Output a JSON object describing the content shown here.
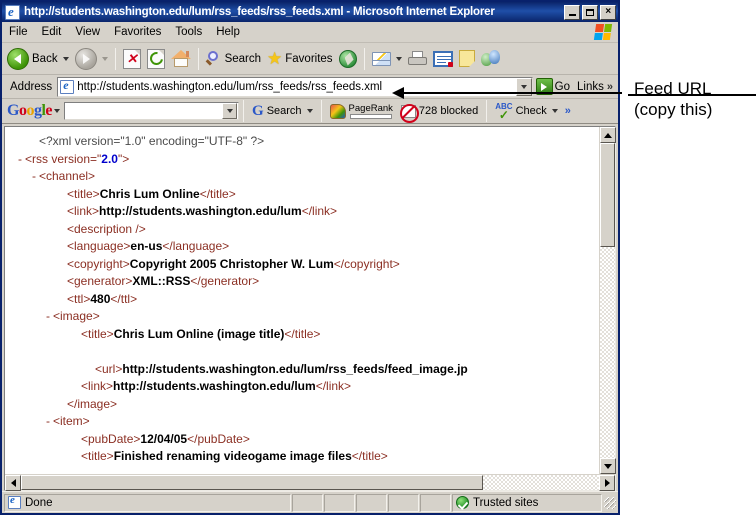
{
  "window": {
    "title": "http://students.washington.edu/lum/rss_feeds/rss_feeds.xml - Microsoft Internet Explorer",
    "icon": "ie-page-icon",
    "minimize_label": "_",
    "maximize_label": "",
    "close_label": "×"
  },
  "menubar": {
    "items": [
      {
        "label": "File"
      },
      {
        "label": "Edit"
      },
      {
        "label": "View"
      },
      {
        "label": "Favorites"
      },
      {
        "label": "Tools"
      },
      {
        "label": "Help"
      }
    ],
    "brand_icon": "windows-flag-icon"
  },
  "toolbar": {
    "back_label": "Back",
    "forward_label": "",
    "search_label": "Search",
    "favorites_label": "Favorites",
    "icons": [
      "back-icon",
      "forward-icon",
      "stop-icon",
      "refresh-icon",
      "home-icon",
      "search-icon",
      "favorites-star-icon",
      "media-icon",
      "mail-icon",
      "print-icon",
      "edit-icon",
      "notes-icon",
      "messenger-icon"
    ]
  },
  "addressbar": {
    "label": "Address",
    "url": "http://students.washington.edu/lum/rss_feeds/rss_feeds.xml",
    "placeholder": "",
    "favicon": "ie-page-icon",
    "go_label": "Go",
    "links_label": "Links",
    "links_chevron": "»"
  },
  "google_toolbar": {
    "logo": "Google",
    "logo_letters": [
      "G",
      "o",
      "o",
      "g",
      "l",
      "e"
    ],
    "search_value": "",
    "search_label": "Search",
    "pagerank_label": "PageRank",
    "blocked_label": "728 blocked",
    "check_label": "Check",
    "overflow_chevron": "»",
    "abc_label": "ABC"
  },
  "xml": {
    "lines": [
      {
        "indent": 1,
        "collapse": "",
        "parts": [
          {
            "c": "pi",
            "t": "<?xml version=\"1.0\" encoding=\"UTF-8\" ?>"
          }
        ]
      },
      {
        "indent": 0,
        "collapse": "-",
        "parts": [
          {
            "c": "tg",
            "t": "<rss version=\""
          },
          {
            "c": "val",
            "t": "2.0"
          },
          {
            "c": "tg",
            "t": "\">"
          }
        ]
      },
      {
        "indent": 1,
        "collapse": "-",
        "parts": [
          {
            "c": "tg",
            "t": "<channel>"
          }
        ]
      },
      {
        "indent": 3,
        "collapse": "",
        "parts": [
          {
            "c": "tg",
            "t": "<title>"
          },
          {
            "c": "txt",
            "t": "Chris Lum Online"
          },
          {
            "c": "tg",
            "t": "</title>"
          }
        ]
      },
      {
        "indent": 3,
        "collapse": "",
        "parts": [
          {
            "c": "tg",
            "t": "<link>"
          },
          {
            "c": "txt",
            "t": "http://students.washington.edu/lum"
          },
          {
            "c": "tg",
            "t": "</link>"
          }
        ]
      },
      {
        "indent": 3,
        "collapse": "",
        "parts": [
          {
            "c": "tg",
            "t": "<description />"
          }
        ]
      },
      {
        "indent": 3,
        "collapse": "",
        "parts": [
          {
            "c": "tg",
            "t": "<language>"
          },
          {
            "c": "txt",
            "t": "en-us"
          },
          {
            "c": "tg",
            "t": "</language>"
          }
        ]
      },
      {
        "indent": 3,
        "collapse": "",
        "parts": [
          {
            "c": "tg",
            "t": "<copyright>"
          },
          {
            "c": "txt",
            "t": "Copyright 2005 Christopher W. Lum"
          },
          {
            "c": "tg",
            "t": "</copyright>"
          }
        ]
      },
      {
        "indent": 3,
        "collapse": "",
        "parts": [
          {
            "c": "tg",
            "t": "<generator>"
          },
          {
            "c": "txt",
            "t": "XML::RSS"
          },
          {
            "c": "tg",
            "t": "</generator>"
          }
        ]
      },
      {
        "indent": 3,
        "collapse": "",
        "parts": [
          {
            "c": "tg",
            "t": "<ttl>"
          },
          {
            "c": "txt",
            "t": "480"
          },
          {
            "c": "tg",
            "t": "</ttl>"
          }
        ]
      },
      {
        "indent": 2,
        "collapse": "-",
        "parts": [
          {
            "c": "tg",
            "t": "<image>"
          }
        ]
      },
      {
        "indent": 4,
        "collapse": "",
        "parts": [
          {
            "c": "tg",
            "t": "<title>"
          },
          {
            "c": "txt",
            "t": "Chris Lum Online (image title)"
          },
          {
            "c": "tg",
            "t": "</title>"
          }
        ]
      },
      {
        "indent": 0,
        "collapse": "",
        "parts": []
      },
      {
        "indent": 5,
        "collapse": "",
        "parts": [
          {
            "c": "tg",
            "t": "<url>"
          },
          {
            "c": "txt",
            "t": "http://students.washington.edu/lum/rss_feeds/feed_image.jp"
          }
        ]
      },
      {
        "indent": 4,
        "collapse": "",
        "parts": [
          {
            "c": "tg",
            "t": "<link>"
          },
          {
            "c": "txt",
            "t": "http://students.washington.edu/lum"
          },
          {
            "c": "tg",
            "t": "</link>"
          }
        ]
      },
      {
        "indent": 3,
        "collapse": "",
        "parts": [
          {
            "c": "tg",
            "t": "</image>"
          }
        ]
      },
      {
        "indent": 2,
        "collapse": "-",
        "parts": [
          {
            "c": "tg",
            "t": "<item>"
          }
        ]
      },
      {
        "indent": 4,
        "collapse": "",
        "parts": [
          {
            "c": "tg",
            "t": "<pubDate>"
          },
          {
            "c": "txt",
            "t": "12/04/05"
          },
          {
            "c": "tg",
            "t": "</pubDate>"
          }
        ]
      },
      {
        "indent": 4,
        "collapse": "",
        "parts": [
          {
            "c": "tg",
            "t": "<title>"
          },
          {
            "c": "txt",
            "t": "Finished renaming videogame image files"
          },
          {
            "c": "tg",
            "t": "</title>"
          }
        ]
      }
    ]
  },
  "statusbar": {
    "status": "Done",
    "zone": "Trusted sites",
    "zone_icon": "trusted-sites-shield-icon"
  },
  "annotation": {
    "line1": "Feed URL",
    "line2": "(copy this)"
  },
  "colors": {
    "titlebar": "#0a246a",
    "chrome": "#d6d2ca",
    "xml_tag": "#8b2f23",
    "xml_value": "#0000cc",
    "xml_text": "#000000",
    "accent_green": "#3f9407"
  }
}
